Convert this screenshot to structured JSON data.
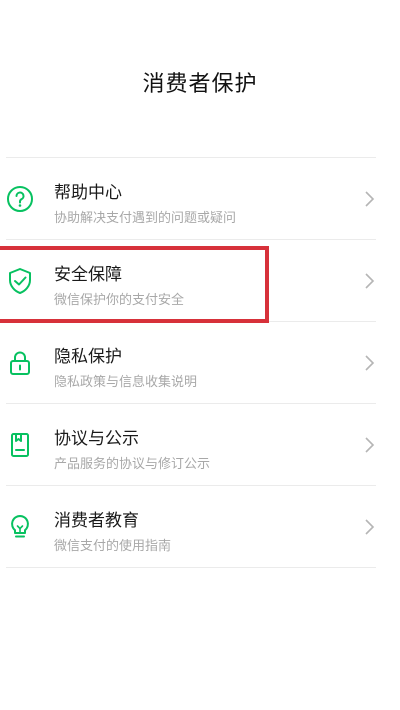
{
  "header": {
    "title": "消费者保护"
  },
  "menu": {
    "items": [
      {
        "title": "帮助中心",
        "subtitle": "协助解决支付遇到的问题或疑问",
        "icon": "help-question-icon"
      },
      {
        "title": "安全保障",
        "subtitle": "微信保护你的支付安全",
        "icon": "shield-check-icon"
      },
      {
        "title": "隐私保护",
        "subtitle": "隐私政策与信息收集说明",
        "icon": "lock-icon"
      },
      {
        "title": "协议与公示",
        "subtitle": "产品服务的协议与修订公示",
        "icon": "document-icon"
      },
      {
        "title": "消费者教育",
        "subtitle": "微信支付的使用指南",
        "icon": "lightbulb-icon"
      }
    ]
  },
  "colors": {
    "icon_green": "#07c160",
    "highlight_red": "#d7313a"
  }
}
